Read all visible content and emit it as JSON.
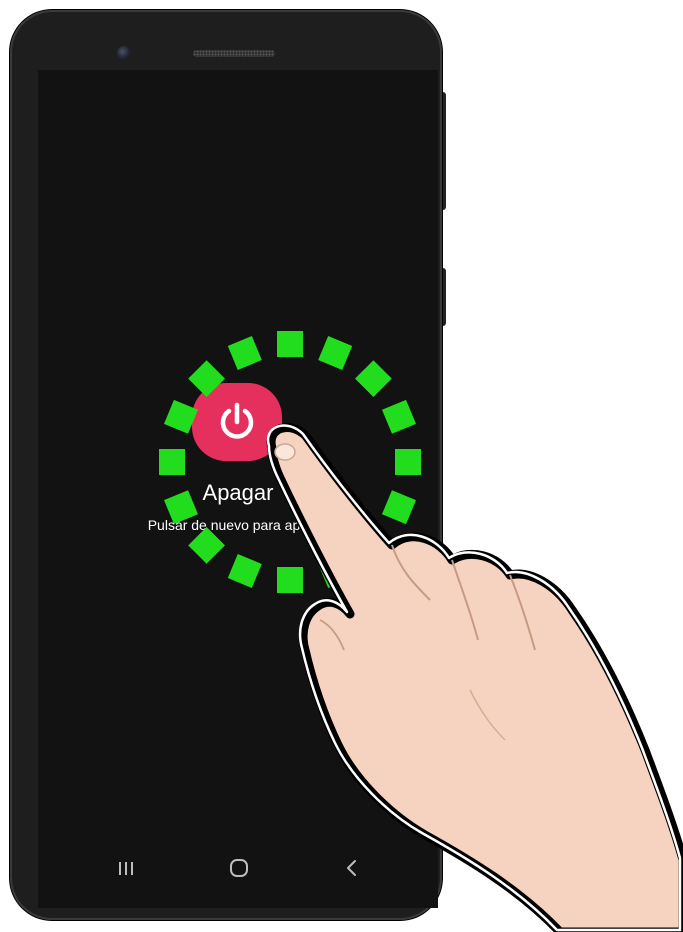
{
  "power_menu": {
    "title": "Apagar",
    "hint": "Pulsar de nuevo para apagar",
    "tile_color": "#e5305e",
    "icon": "power-icon"
  },
  "gesture": {
    "type": "tap",
    "ring_color": "#22dd1e",
    "ring_style": "dashed"
  },
  "navigation": {
    "buttons": [
      "recents-icon",
      "home-icon",
      "back-icon"
    ]
  }
}
